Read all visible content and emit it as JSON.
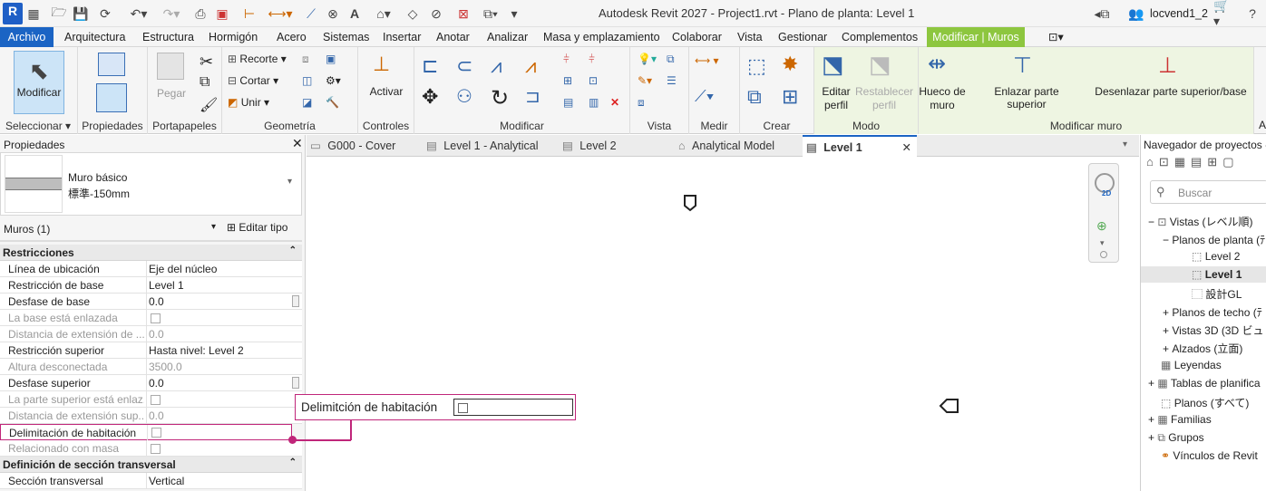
{
  "app": {
    "logo_letter": "R",
    "title": "Autodesk Revit 2027 - Project1.rvt - Plano de planta: Level 1",
    "user": "locvend1_2"
  },
  "ribbon_tabs": [
    "Archivo",
    "Arquitectura",
    "Estructura",
    "Hormigón",
    "Acero",
    "Sistemas",
    "Insertar",
    "Anotar",
    "Analizar",
    "Masa y emplazamiento",
    "Colaborar",
    "Vista",
    "Gestionar",
    "Complementos",
    "Modificar | Muros"
  ],
  "ribbon": {
    "seleccionar": {
      "button": "Modificar",
      "label": "Seleccionar"
    },
    "propiedades": {
      "label": "Propiedades"
    },
    "portapapeles": {
      "paste": "Pegar",
      "label": "Portapapeles"
    },
    "geometria": {
      "cut": "Recorte",
      "cortar": "Cortar",
      "join": "Unir",
      "label": "Geometría"
    },
    "controles": {
      "button": "Activar",
      "label": "Controles"
    },
    "modificar": {
      "label": "Modificar"
    },
    "vista": {
      "label": "Vista"
    },
    "medir": {
      "label": "Medir"
    },
    "crear": {
      "label": "Crear"
    },
    "modo": {
      "edit_profile": "Editar perfil",
      "reset_profile": "Restablecer perfil",
      "label": "Modo"
    },
    "modificar_muro": {
      "opening": "Hueco de muro",
      "attach": "Enlazar parte superior",
      "detach": "Desenlazar parte superior/base",
      "label": "Modificar muro"
    }
  },
  "properties": {
    "title": "Propiedades",
    "type_family": "Muro básico",
    "type_name": "標準-150mm",
    "instance_filter": "Muros (1)",
    "edit_type": "Editar tipo",
    "groups": [
      {
        "name": "Restricciones",
        "rows": [
          {
            "name": "Línea de ubicación",
            "value": "Eje del núcleo"
          },
          {
            "name": "Restricción de base",
            "value": "Level 1"
          },
          {
            "name": "Desfase de base",
            "value": "0.0"
          },
          {
            "name": "La base está enlazada",
            "value": ""
          },
          {
            "name": "Distancia de extensión de ...",
            "value": "0.0"
          },
          {
            "name": "Restricción superior",
            "value": "Hasta nivel: Level 2"
          },
          {
            "name": "Altura desconectada",
            "value": "3500.0"
          },
          {
            "name": "Desfase superior",
            "value": "0.0"
          },
          {
            "name": "La parte superior está enlaz...",
            "value": ""
          },
          {
            "name": "Distancia de extensión sup...",
            "value": "0.0"
          },
          {
            "name": "Delimitación de habitación",
            "value": ""
          },
          {
            "name": "Relacionado con masa",
            "value": ""
          }
        ]
      },
      {
        "name": "Definición de sección transversal",
        "rows": [
          {
            "name": "Sección transversal",
            "value": "Vertical"
          }
        ]
      }
    ]
  },
  "view_tabs": [
    "G000 - Cover",
    "Level 1 - Analytical",
    "Level 2",
    "Analytical Model",
    "Level 1"
  ],
  "callout": {
    "label": "Delimitción de habitación"
  },
  "nav_badge": "2D",
  "browser": {
    "title": "Navegador de proyectos -",
    "search_placeholder": "Buscar",
    "tree": [
      "Vistas (レベル順)",
      "Planos de planta (ﾃ",
      "Level 2",
      "Level 1",
      "設計GL",
      "Planos de techo (ﾃ",
      "Vistas 3D (3D ビュ",
      "Alzados (立面)",
      "Leyendas",
      "Tablas de planifica",
      "Planos (すべて)",
      "Familias",
      "Grupos",
      "Vínculos de Revit"
    ]
  },
  "colors": {
    "accent": "#1b64c4",
    "contextual": "#8dc63f",
    "callout": "#c0267a"
  }
}
